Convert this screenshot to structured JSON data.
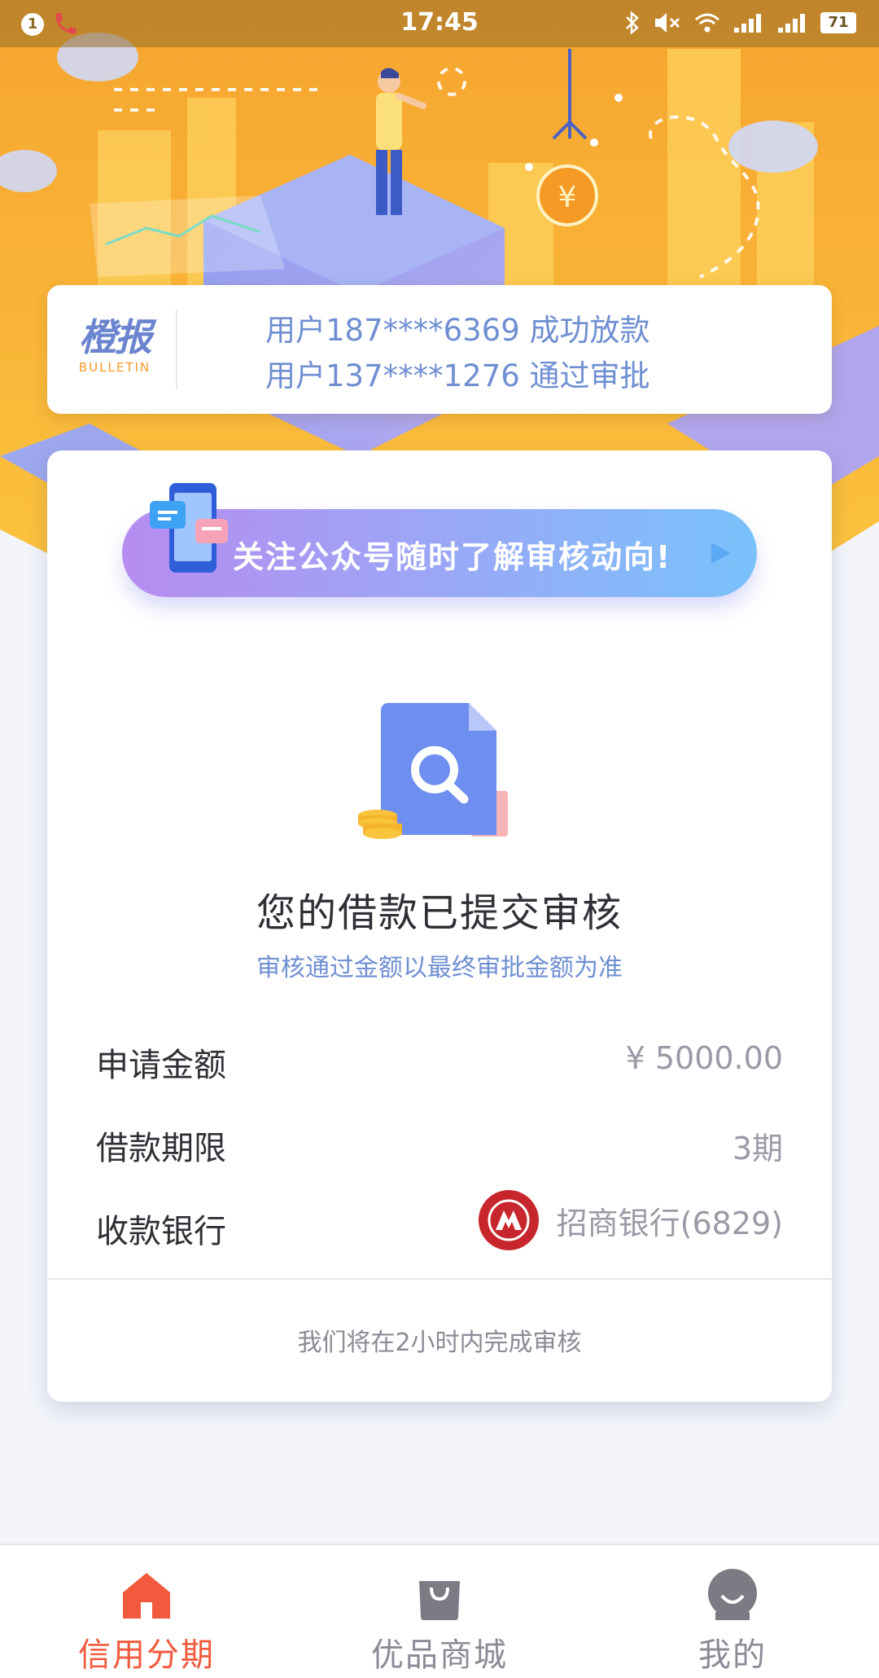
{
  "status_bar": {
    "notification_count": "1",
    "time": "17:45",
    "battery": "71"
  },
  "bulletin": {
    "logo_cn": "橙报",
    "logo_en": "BULLETIN",
    "lines": [
      "用户187****6369 成功放款",
      "用户137****1276 通过审批"
    ]
  },
  "follow_banner": {
    "text": "关注公众号随时了解审核动向!"
  },
  "result": {
    "title": "您的借款已提交审核",
    "subtitle": "审核通过金额以最终审批金额为准"
  },
  "details": [
    {
      "label": "申请金额",
      "value": "¥ 5000.00"
    },
    {
      "label": "借款期限",
      "value": "3期"
    },
    {
      "label": "收款银行",
      "value": "招商银行(6829)"
    }
  ],
  "footer_note": "我们将在2小时内完成审核",
  "tabs": [
    {
      "label": "信用分期",
      "icon": "home-icon",
      "active": true
    },
    {
      "label": "优品商城",
      "icon": "shopping-bag-icon",
      "active": false
    },
    {
      "label": "我的",
      "icon": "profile-icon",
      "active": false
    }
  ],
  "colors": {
    "accent": "#f15a3c",
    "link_blue": "#6f8fd2",
    "bank_red": "#c8262d",
    "hero_orange": "#f7a531"
  }
}
